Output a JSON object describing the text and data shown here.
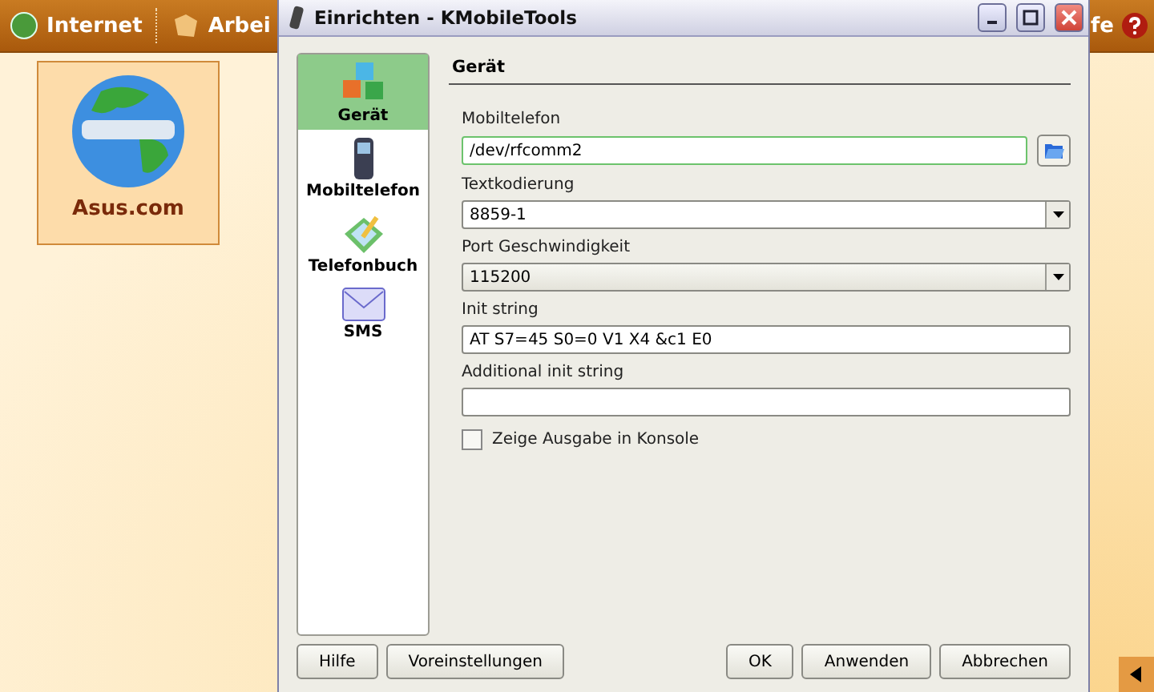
{
  "desktop": {
    "panel": [
      {
        "label": "Internet"
      },
      {
        "label": "Arbei"
      }
    ],
    "panel_right": {
      "label": "fe"
    },
    "icons": [
      {
        "label": "Asus.com",
        "selected": true
      }
    ]
  },
  "dialog": {
    "title": "Einrichten - KMobileTools",
    "nav": [
      {
        "label": "Gerät",
        "selected": true
      },
      {
        "label": "Mobiltelefon",
        "selected": false
      },
      {
        "label": "Telefonbuch",
        "selected": false
      },
      {
        "label": "SMS",
        "selected": false
      }
    ],
    "section_title": "Gerät",
    "fields": [
      {
        "kind": "text",
        "label": "Mobiltelefon",
        "value": "/dev/rfcomm2",
        "focused": true,
        "browse": true
      },
      {
        "kind": "editable-combo",
        "label": "Textkodierung",
        "value": "8859-1"
      },
      {
        "kind": "combo",
        "label": "Port Geschwindigkeit",
        "value": "115200"
      },
      {
        "kind": "text",
        "label": "Init string",
        "value": "AT S7=45 S0=0 V1 X4 &c1 E0",
        "focused": false
      },
      {
        "kind": "text",
        "label": "Additional init string",
        "focused": false
      }
    ],
    "checkbox": {
      "label": "Zeige Ausgabe in Konsole",
      "checked": false
    },
    "buttons_left": [
      "Hilfe",
      "Voreinstellungen"
    ],
    "buttons_right": [
      "OK",
      "Anwenden",
      "Abbrechen"
    ]
  }
}
